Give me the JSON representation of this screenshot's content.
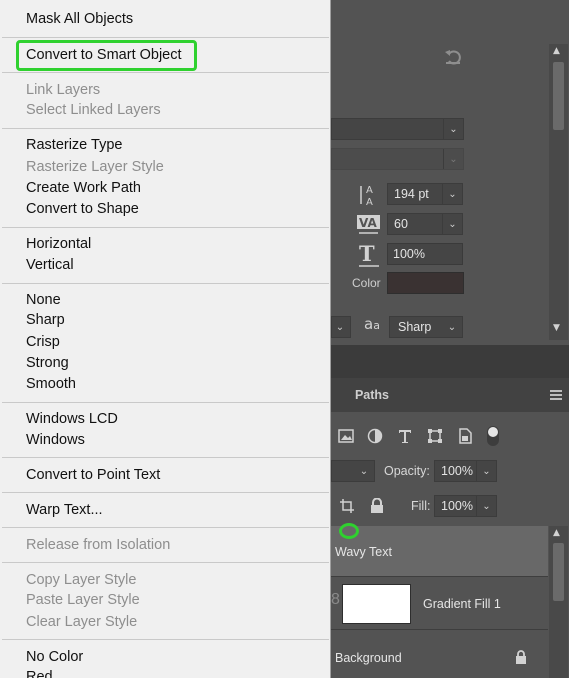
{
  "context_menu": {
    "items": [
      {
        "label": "Mask All Objects",
        "enabled": true
      },
      {
        "label": "Convert to Smart Object",
        "enabled": true,
        "highlighted": true
      },
      {
        "label": "Link Layers",
        "enabled": false
      },
      {
        "label": "Select Linked Layers",
        "enabled": false
      },
      {
        "label": "Rasterize Type",
        "enabled": true
      },
      {
        "label": "Rasterize Layer Style",
        "enabled": false
      },
      {
        "label": "Create Work Path",
        "enabled": true
      },
      {
        "label": "Convert to Shape",
        "enabled": true
      },
      {
        "label": "Horizontal",
        "enabled": true
      },
      {
        "label": "Vertical",
        "enabled": true
      },
      {
        "label": "None",
        "enabled": true
      },
      {
        "label": "Sharp",
        "enabled": true
      },
      {
        "label": "Crisp",
        "enabled": true
      },
      {
        "label": "Strong",
        "enabled": true
      },
      {
        "label": "Smooth",
        "enabled": true
      },
      {
        "label": "Windows LCD",
        "enabled": true
      },
      {
        "label": "Windows",
        "enabled": true
      },
      {
        "label": "Convert to Point Text",
        "enabled": true
      },
      {
        "label": "Warp Text...",
        "enabled": true
      },
      {
        "label": "Release from Isolation",
        "enabled": false
      },
      {
        "label": "Copy Layer Style",
        "enabled": false
      },
      {
        "label": "Paste Layer Style",
        "enabled": false
      },
      {
        "label": "Clear Layer Style",
        "enabled": false
      },
      {
        "label": "No Color",
        "enabled": true
      },
      {
        "label": "Red",
        "enabled": true
      }
    ],
    "highlight_color": "#2fd12f"
  },
  "properties": {
    "leading_value": "194 pt",
    "tracking_value": "60",
    "vertical_scale_value": "100%",
    "color_label": "Color",
    "color_value": "#3a3232",
    "antialias_icon_text": "a",
    "antialias_icon_subtext": "a",
    "antialias_value": "Sharp"
  },
  "layers": {
    "tab_paths": "Paths",
    "opacity_label": "Opacity:",
    "opacity_value": "100%",
    "fill_label": "Fill:",
    "fill_value": "100%",
    "rows": [
      {
        "name": "Wavy Text",
        "selected": true
      },
      {
        "name": "Gradient Fill 1",
        "selected": false
      },
      {
        "name": "Background",
        "selected": false,
        "locked": true
      }
    ]
  }
}
